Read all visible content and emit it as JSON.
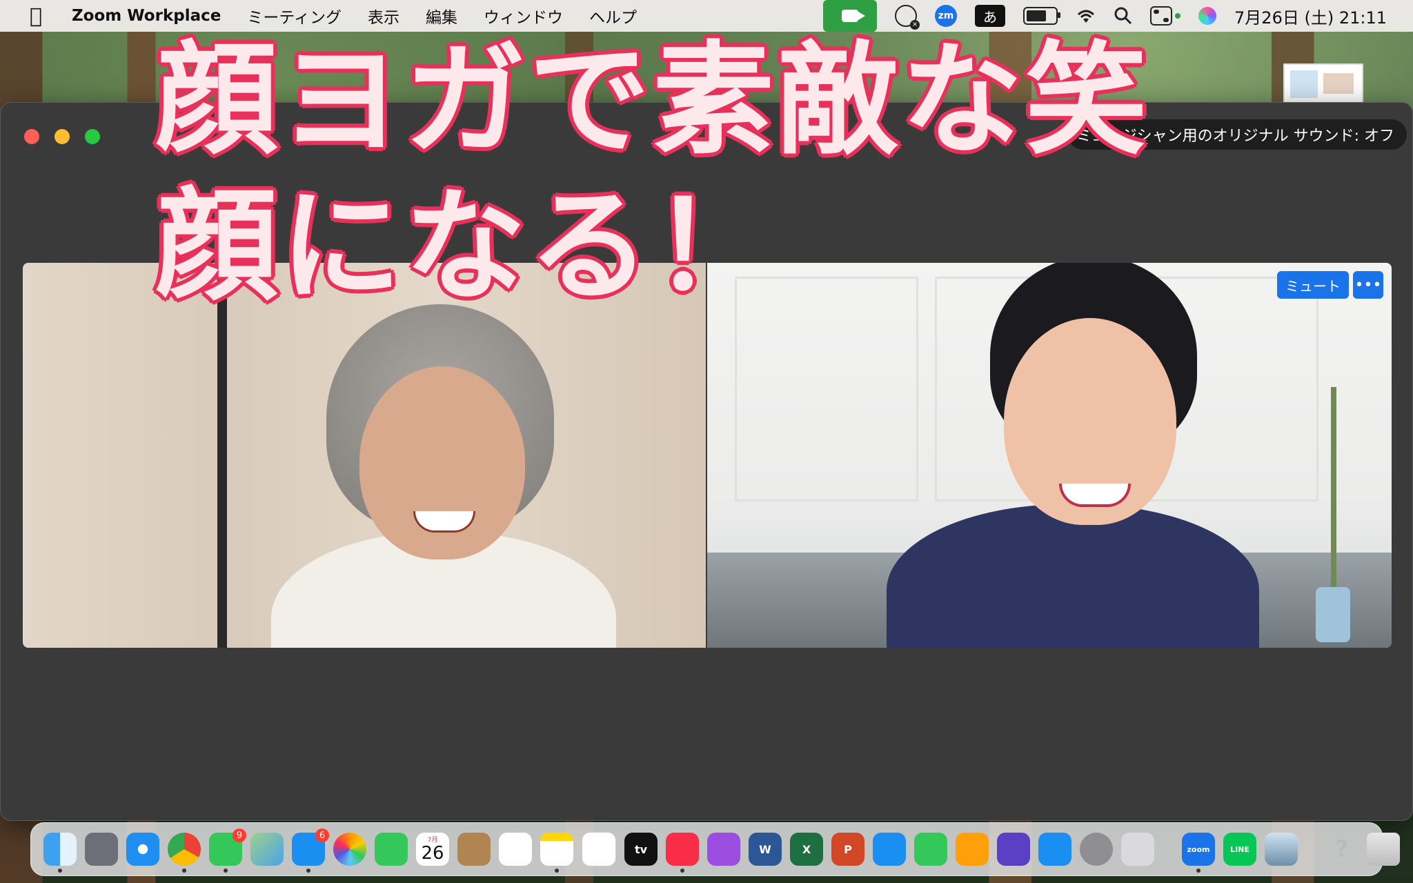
{
  "menubar": {
    "app_name": "Zoom Workplace",
    "menus": [
      "ミーティング",
      "表示",
      "編集",
      "ウィンドウ",
      "ヘルプ"
    ],
    "ime_label": "あ",
    "zoom_badge": "zm",
    "clock": "7月26日 (土)  21:11"
  },
  "zoom_window": {
    "sound_toggle": "ミュージシャン用のオリジナル サウンド: オフ",
    "mute_button": "ミュート",
    "more_button": "•••"
  },
  "overlay": {
    "line1": "顔ヨガで素敵な笑",
    "line2": "顔になる！"
  },
  "dock": {
    "calendar_month": "7月",
    "calendar_day": "26",
    "messages_badge": "9",
    "mail_badge": "6",
    "tv_label": "tv",
    "zoom_label": "zoom",
    "line_label": "LINE",
    "word_label": "W",
    "excel_label": "X",
    "ppt_label": "P",
    "help_label": "?"
  },
  "colors": {
    "title_fill": "#fde8ec",
    "title_stroke": "#e8315a",
    "zoom_blue": "#1a73e8",
    "zoom_green": "#2ea043"
  }
}
